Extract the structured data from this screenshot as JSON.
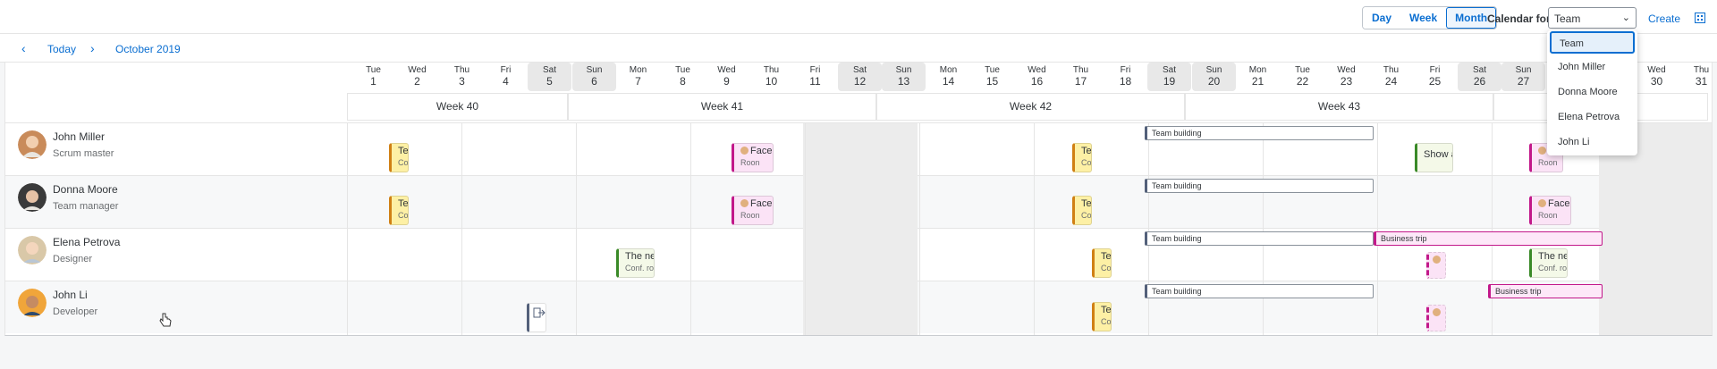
{
  "toolbar": {
    "views": [
      "Day",
      "Week",
      "Month"
    ],
    "active_view": "Month",
    "calendar_for_label": "Calendar for:",
    "selected": "Team",
    "create_label": "Create"
  },
  "nav": {
    "today_label": "Today",
    "period_label": "October 2019"
  },
  "days": [
    {
      "dow": "Tue",
      "d": "1",
      "we": false
    },
    {
      "dow": "Wed",
      "d": "2",
      "we": false
    },
    {
      "dow": "Thu",
      "d": "3",
      "we": false
    },
    {
      "dow": "Fri",
      "d": "4",
      "we": false
    },
    {
      "dow": "Sat",
      "d": "5",
      "we": true
    },
    {
      "dow": "Sun",
      "d": "6",
      "we": true
    },
    {
      "dow": "Mon",
      "d": "7",
      "we": false
    },
    {
      "dow": "Tue",
      "d": "8",
      "we": false
    },
    {
      "dow": "Wed",
      "d": "9",
      "we": false
    },
    {
      "dow": "Thu",
      "d": "10",
      "we": false
    },
    {
      "dow": "Fri",
      "d": "11",
      "we": false
    },
    {
      "dow": "Sat",
      "d": "12",
      "we": true
    },
    {
      "dow": "Sun",
      "d": "13",
      "we": true
    },
    {
      "dow": "Mon",
      "d": "14",
      "we": false
    },
    {
      "dow": "Tue",
      "d": "15",
      "we": false
    },
    {
      "dow": "Wed",
      "d": "16",
      "we": false
    },
    {
      "dow": "Thu",
      "d": "17",
      "we": false
    },
    {
      "dow": "Fri",
      "d": "18",
      "we": false
    },
    {
      "dow": "Sat",
      "d": "19",
      "we": true
    },
    {
      "dow": "Sun",
      "d": "20",
      "we": true
    },
    {
      "dow": "Mon",
      "d": "21",
      "we": false
    },
    {
      "dow": "Tue",
      "d": "22",
      "we": false
    },
    {
      "dow": "Wed",
      "d": "23",
      "we": false
    },
    {
      "dow": "Thu",
      "d": "24",
      "we": false
    },
    {
      "dow": "Fri",
      "d": "25",
      "we": false
    },
    {
      "dow": "Sat",
      "d": "26",
      "we": true
    },
    {
      "dow": "Sun",
      "d": "27",
      "we": true
    },
    {
      "dow": "Wed",
      "d": "30",
      "we": false
    },
    {
      "dow": "Thu",
      "d": "31",
      "we": false
    }
  ],
  "weeks": [
    "Week 40",
    "Week 41",
    "Week 42",
    "Week 43"
  ],
  "people": [
    {
      "name": "John Miller",
      "role": "Scrum master"
    },
    {
      "name": "Donna Moore",
      "role": "Team manager"
    },
    {
      "name": "Elena Petrova",
      "role": "Designer"
    },
    {
      "name": "John Li",
      "role": "Developer"
    }
  ],
  "dropdown_items": [
    "Team",
    "John Miller",
    "Donna Moore",
    "Elena Petrova",
    "John Li"
  ],
  "appointments": {
    "te": "Te",
    "co": "Co",
    "face": "Face",
    "roon": "Roon",
    "the_ne": "The ne",
    "conf_ro": "Conf. ro",
    "show": "Show a",
    "team_building": "Team building",
    "business_trip": "Business trip"
  }
}
